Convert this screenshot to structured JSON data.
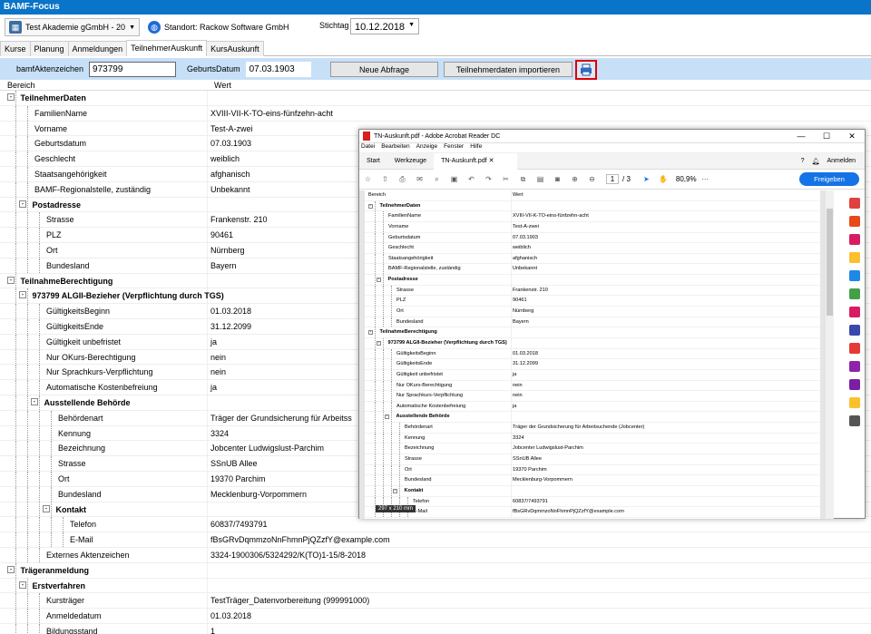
{
  "app": {
    "title": "BAMF-Focus"
  },
  "toolbar": {
    "academy": "Test Akademie gGmbH - 20",
    "location": "Standort: Rackow Software GmbH",
    "stichtag_label": "Stichtag",
    "stichtag_value": "10.12.2018"
  },
  "tabs": [
    "Kurse",
    "Planung",
    "Anmeldungen",
    "TeilnehmerAuskunft",
    "KursAuskunft"
  ],
  "search": {
    "akten_label": "bamfAktenzeichen",
    "akten_value": "973799",
    "geburt_label": "GeburtsDatum",
    "geburt_value": "07.03.1903",
    "btn_query": "Neue Abfrage",
    "btn_import": "Teilnehmerdaten importieren"
  },
  "grid": {
    "col1": "Bereich",
    "col2": "Wert",
    "rows": [
      {
        "k": "TeilnehmerDaten",
        "v": "",
        "d": 0,
        "bold": true,
        "tog": "-"
      },
      {
        "k": "FamilienName",
        "v": "XVIII-VII-K-TO-eins-fünfzehn-acht",
        "d": 1
      },
      {
        "k": "Vorname",
        "v": "Test-A-zwei",
        "d": 1
      },
      {
        "k": "Geburtsdatum",
        "v": "07.03.1903",
        "d": 1
      },
      {
        "k": "Geschlecht",
        "v": "weiblich",
        "d": 1
      },
      {
        "k": "Staatsangehörigkeit",
        "v": "afghanisch",
        "d": 1
      },
      {
        "k": "BAMF-Regionalstelle, zuständig",
        "v": "Unbekannt",
        "d": 1
      },
      {
        "k": "Postadresse",
        "v": "",
        "d": 1,
        "bold": true,
        "tog": "-"
      },
      {
        "k": "Strasse",
        "v": "Frankenstr. 210",
        "d": 2
      },
      {
        "k": "PLZ",
        "v": "90461",
        "d": 2
      },
      {
        "k": "Ort",
        "v": "Nürnberg",
        "d": 2
      },
      {
        "k": "Bundesland",
        "v": "Bayern",
        "d": 2
      },
      {
        "k": "TeilnahmeBerechtigung",
        "v": "",
        "d": 0,
        "bold": true,
        "tog": "-"
      },
      {
        "k": "973799 ALGII-Bezieher (Verpflichtung durch TGS)",
        "v": "",
        "d": 1,
        "bold": true,
        "tog": "-"
      },
      {
        "k": "GültigkeitsBeginn",
        "v": "01.03.2018",
        "d": 2
      },
      {
        "k": "GültigkeitsEnde",
        "v": "31.12.2099",
        "d": 2
      },
      {
        "k": "Gültigkeit unbefristet",
        "v": "ja",
        "d": 2
      },
      {
        "k": "Nur OKurs-Berechtigung",
        "v": "nein",
        "d": 2
      },
      {
        "k": "Nur Sprachkurs-Verpflichtung",
        "v": "nein",
        "d": 2
      },
      {
        "k": "Automatische Kostenbefreiung",
        "v": "ja",
        "d": 2
      },
      {
        "k": "Ausstellende Behörde",
        "v": "",
        "d": 2,
        "bold": true,
        "tog": "-"
      },
      {
        "k": "Behördenart",
        "v": "Träger der Grundsicherung für Arbeitss",
        "d": 3
      },
      {
        "k": "Kennung",
        "v": "3324",
        "d": 3
      },
      {
        "k": "Bezeichnung",
        "v": "Jobcenter Ludwigslust-Parchim",
        "d": 3
      },
      {
        "k": "Strasse",
        "v": "SSnUB Allee",
        "d": 3
      },
      {
        "k": "Ort",
        "v": "19370 Parchim",
        "d": 3
      },
      {
        "k": "Bundesland",
        "v": "Mecklenburg-Vorpommern",
        "d": 3
      },
      {
        "k": "Kontakt",
        "v": "",
        "d": 3,
        "bold": true,
        "tog": "-"
      },
      {
        "k": "Telefon",
        "v": "60837/7493791",
        "d": 4
      },
      {
        "k": "E-Mail",
        "v": "fBsGRvDqmmzoNnFhmnPjQZzfY@example.com",
        "d": 4
      },
      {
        "k": "Externes Aktenzeichen",
        "v": "3324-1900306/5324292/K(TO)1-15/8-2018",
        "d": 2
      },
      {
        "k": "Trägeranmeldung",
        "v": "",
        "d": 0,
        "bold": true,
        "tog": "-"
      },
      {
        "k": "Erstverfahren",
        "v": "",
        "d": 1,
        "bold": true,
        "tog": "-"
      },
      {
        "k": "Kursträger",
        "v": "TestTräger_Datenvorbereitung (999991000)",
        "d": 2
      },
      {
        "k": "Anmeldedatum",
        "v": "01.03.2018",
        "d": 2
      },
      {
        "k": "Bildungsstand",
        "v": "1",
        "d": 2
      }
    ]
  },
  "acrobat": {
    "title": "TN-Auskunft.pdf - Adobe Acrobat Reader DC",
    "menu": [
      "Datei",
      "Bearbeiten",
      "Anzeige",
      "Fenster",
      "Hilfe"
    ],
    "tab_start": "Start",
    "tab_tools": "Werkzeuge",
    "tab_doc": "TN-Auskunft.pdf",
    "signin": "Anmelden",
    "page_num": "1",
    "page_total": "/ 3",
    "zoom": "80,9%",
    "share": "Freigeben",
    "size": "297 x 210 mm",
    "rows": [
      {
        "k": "Bereich",
        "v": "Wert",
        "d": -1
      },
      {
        "k": "TeilnehmerDaten",
        "v": "",
        "d": 0,
        "bold": true,
        "tog": "-"
      },
      {
        "k": "FamilienName",
        "v": "XVIII-VII-K-TO-eins-fünfzehn-acht",
        "d": 1
      },
      {
        "k": "Vorname",
        "v": "Test-A-zwei",
        "d": 1
      },
      {
        "k": "Geburtsdatum",
        "v": "07.03.1903",
        "d": 1
      },
      {
        "k": "Geschlecht",
        "v": "weiblich",
        "d": 1
      },
      {
        "k": "Staatsangehörigkeit",
        "v": "afghanisch",
        "d": 1
      },
      {
        "k": "BAMF-Regionalstelle, zuständig",
        "v": "Unbekannt",
        "d": 1
      },
      {
        "k": "Postadresse",
        "v": "",
        "d": 1,
        "bold": true,
        "tog": "-"
      },
      {
        "k": "Strasse",
        "v": "Frankenstr. 210",
        "d": 2
      },
      {
        "k": "PLZ",
        "v": "90461",
        "d": 2
      },
      {
        "k": "Ort",
        "v": "Nürnberg",
        "d": 2
      },
      {
        "k": "Bundesland",
        "v": "Bayern",
        "d": 2
      },
      {
        "k": "TeilnahmeBerechtigung",
        "v": "",
        "d": 0,
        "bold": true,
        "tog": "-"
      },
      {
        "k": "973799 ALGII-Bezieher (Verpflichtung durch TGS)",
        "v": "",
        "d": 1,
        "bold": true,
        "tog": "-"
      },
      {
        "k": "GültigkeitsBeginn",
        "v": "01.03.2018",
        "d": 2
      },
      {
        "k": "GültigkeitsEnde",
        "v": "31.12.2099",
        "d": 2
      },
      {
        "k": "Gültigkeit unbefristet",
        "v": "ja",
        "d": 2
      },
      {
        "k": "Nur OKurs-Berechtigung",
        "v": "nein",
        "d": 2
      },
      {
        "k": "Nur Sprachkurs-Verpflichtung",
        "v": "nein",
        "d": 2
      },
      {
        "k": "Automatische Kostenbefreiung",
        "v": "ja",
        "d": 2
      },
      {
        "k": "Ausstellende Behörde",
        "v": "",
        "d": 2,
        "bold": true,
        "tog": "-"
      },
      {
        "k": "Behördenart",
        "v": "Träger der Grundsicherung für Arbeitsuchende (Jobcenter)",
        "d": 3
      },
      {
        "k": "Kennung",
        "v": "3324",
        "d": 3
      },
      {
        "k": "Bezeichnung",
        "v": "Jobcenter Ludwigslust-Parchim",
        "d": 3
      },
      {
        "k": "Strasse",
        "v": "SSnUB Allee",
        "d": 3
      },
      {
        "k": "Ort",
        "v": "19370 Parchim",
        "d": 3
      },
      {
        "k": "Bundesland",
        "v": "Mecklenburg-Vorpommern",
        "d": 3
      },
      {
        "k": "Kontakt",
        "v": "",
        "d": 3,
        "bold": true,
        "tog": "-"
      },
      {
        "k": "Telefon",
        "v": "60837/7493791",
        "d": 4
      },
      {
        "k": "E-Mail",
        "v": "fBsGRvDqmmzoNnFhmnPjQZzfY@example.com",
        "d": 4
      }
    ]
  },
  "colors": {
    "titlebar": "#0a74c8",
    "searchbar": "#c7e0f8",
    "highlight": "#e00000",
    "share": "#1473e6"
  }
}
